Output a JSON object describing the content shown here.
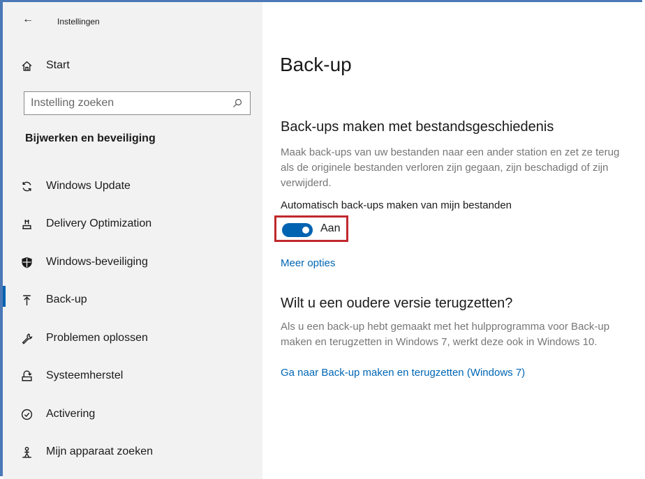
{
  "window": {
    "title": "Instellingen",
    "back_icon": "arrow-left-icon"
  },
  "sidebar": {
    "home_label": "Start",
    "search": {
      "placeholder": "Instelling zoeken",
      "icon": "search-icon"
    },
    "section_title": "Bijwerken en beveiliging",
    "items": [
      {
        "label": "Windows Update",
        "icon": "sync-icon"
      },
      {
        "label": "Delivery Optimization",
        "icon": "delivery-optimization-icon"
      },
      {
        "label": "Windows-beveiliging",
        "icon": "shield-icon"
      },
      {
        "label": "Back-up",
        "icon": "backup-arrow-up-icon",
        "selected": true
      },
      {
        "label": "Problemen oplossen",
        "icon": "wrench-icon"
      },
      {
        "label": "Systeemherstel",
        "icon": "recovery-icon"
      },
      {
        "label": "Activering",
        "icon": "check-circle-icon"
      },
      {
        "label": "Mijn apparaat zoeken",
        "icon": "person-location-icon"
      }
    ]
  },
  "main": {
    "page_title": "Back-up",
    "file_history": {
      "heading": "Back-ups maken met bestandsgeschiedenis",
      "description": "Maak back-ups van uw bestanden naar een ander station en zet ze terug als de originele bestanden verloren zijn gegaan, zijn beschadigd of zijn verwijderd.",
      "toggle_label": "Automatisch back-ups maken van mijn bestanden",
      "toggle_state": "Aan",
      "more_options": "Meer opties"
    },
    "restore": {
      "heading": "Wilt u een oudere versie terugzetten?",
      "description": "Als u een back-up hebt gemaakt met het hulpprogramma voor Back-up maken en terugzetten in Windows 7, werkt deze ook in Windows 10.",
      "link": "Ga naar Back-up maken en terugzetten (Windows 7)"
    }
  },
  "colors": {
    "accent": "#0063b1",
    "link": "#0066b4",
    "highlight_border": "#c0282d",
    "frame": "#4b78b7"
  }
}
